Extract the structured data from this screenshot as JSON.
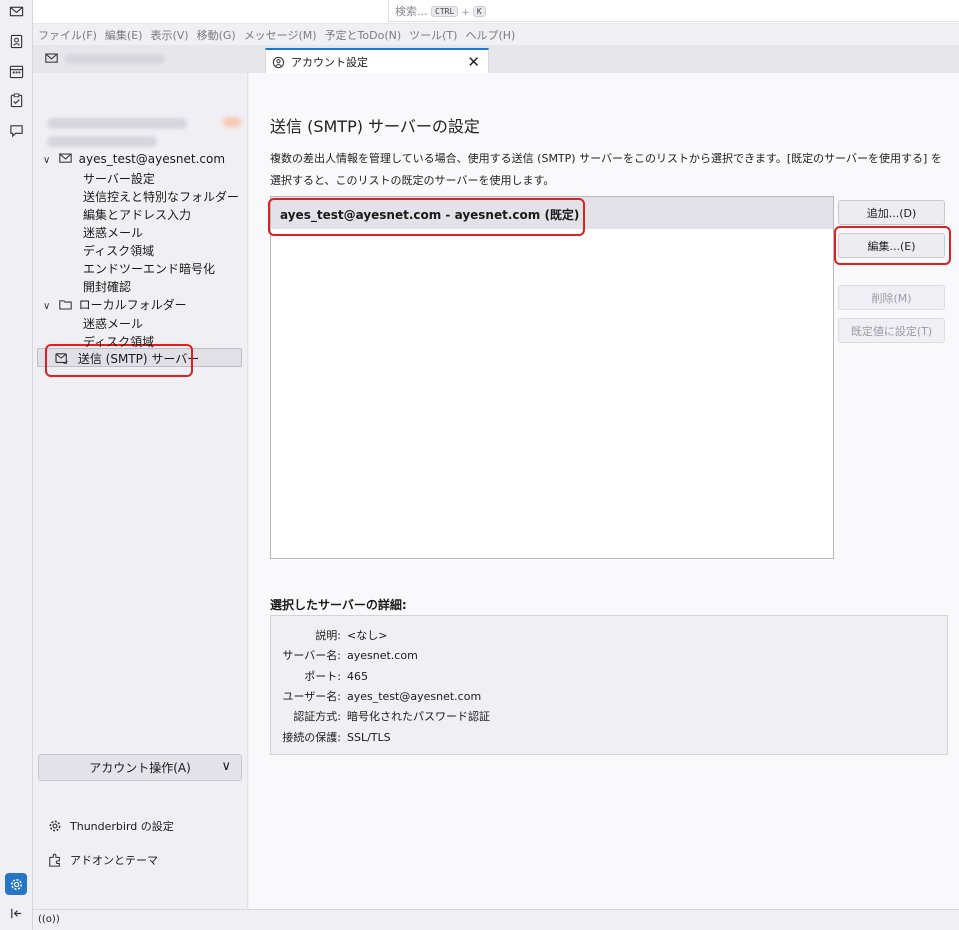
{
  "search": {
    "placeholder": "検索...",
    "key1": "CTRL",
    "plus": "+",
    "key2": "K"
  },
  "menubar": [
    "ファイル(F)",
    "編集(E)",
    "表示(V)",
    "移動(G)",
    "メッセージ(M)",
    "予定とToDo(N)",
    "ツール(T)",
    "ヘルプ(H)"
  ],
  "tabs": {
    "account_tab": "アカウント設定",
    "close": "✕"
  },
  "tree": {
    "account_email": "ayes_test@ayesnet.com",
    "account_children": [
      "サーバー設定",
      "送信控えと特別なフォルダー",
      "編集とアドレス入力",
      "迷惑メール",
      "ディスク領域",
      "エンドツーエンド暗号化",
      "開封確認"
    ],
    "local_folders": "ローカルフォルダー",
    "local_children": [
      "迷惑メール",
      "ディスク領域"
    ],
    "smtp": "送信 (SMTP) サーバー"
  },
  "sidebar_footer": {
    "account_actions": "アカウント操作(A)",
    "thunderbird_settings": "Thunderbird の設定",
    "addons": "アドオンとテーマ"
  },
  "main": {
    "title": "送信 (SMTP) サーバーの設定",
    "description": "複数の差出人情報を管理している場合、使用する送信 (SMTP) サーバーをこのリストから選択できます。[既定のサーバーを使用する] を選択すると、このリストの既定のサーバーを使用します。",
    "servers": [
      "ayes_test@ayesnet.com - ayesnet.com (既定)"
    ],
    "buttons": {
      "add": "追加...(D)",
      "edit": "編集...(E)",
      "delete": "削除(M)",
      "set_default": "既定値に設定(T)"
    },
    "details_title": "選択したサーバーの詳細:",
    "details": [
      {
        "label": "説明:",
        "value": "<なし>"
      },
      {
        "label": "サーバー名:",
        "value": "ayesnet.com"
      },
      {
        "label": "ポート:",
        "value": "465"
      },
      {
        "label": "ユーザー名:",
        "value": "ayes_test@ayesnet.com"
      },
      {
        "label": "認証方式:",
        "value": "暗号化されたパスワード認証"
      },
      {
        "label": "接続の保護:",
        "value": "SSL/TLS"
      }
    ]
  },
  "status": {
    "icon": "((o))"
  },
  "colors": {
    "accent": "#2775c7",
    "highlight": "#e0201f"
  }
}
